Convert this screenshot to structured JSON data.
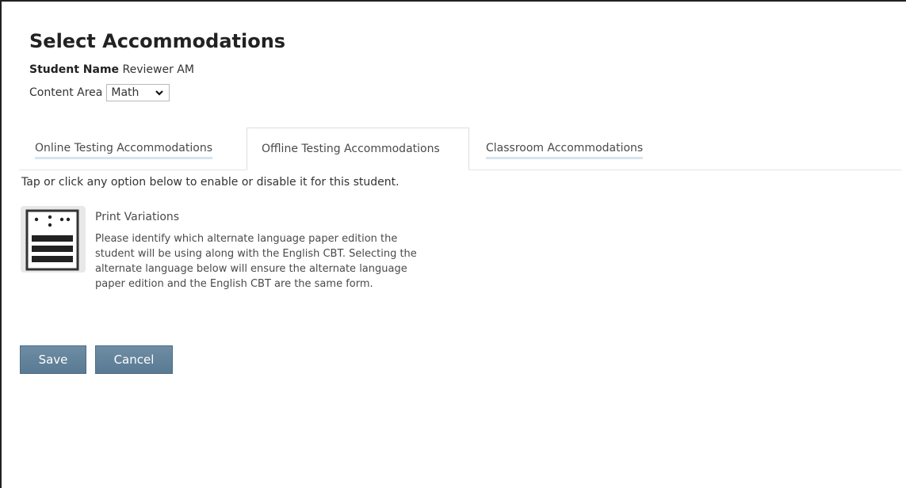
{
  "header": {
    "title": "Select Accommodations",
    "student_label": "Student Name",
    "student_name": "Reviewer AM",
    "content_area_label": "Content Area",
    "content_area_value": "Math"
  },
  "tabs": [
    {
      "label": "Online Testing Accommodations",
      "active": false
    },
    {
      "label": "Offline Testing Accommodations",
      "active": true
    },
    {
      "label": "Classroom Accommodations",
      "active": false
    }
  ],
  "instructions": "Tap or click any option below to enable or disable it for this student.",
  "accommodation": {
    "icon": "print-variations-icon",
    "title": "Print Variations",
    "description": "Please identify which alternate language paper edition the student will be using along with the English CBT. Selecting the alternate language below will ensure the alternate language paper edition and the English CBT are the same form."
  },
  "buttons": {
    "save": "Save",
    "cancel": "Cancel"
  },
  "colors": {
    "button": "#6383a0",
    "tab_underline": "#d6e4ef"
  }
}
